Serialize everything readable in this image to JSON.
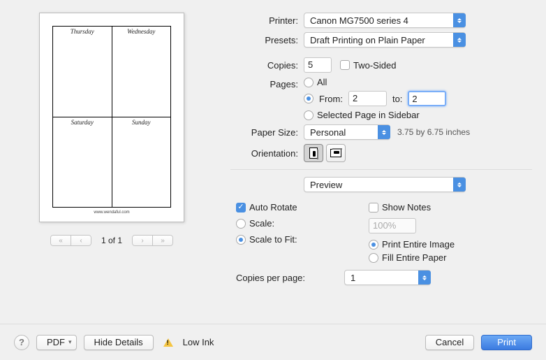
{
  "preview": {
    "cells": [
      "Thursday",
      "Wednesday",
      "Saturday",
      "Sunday"
    ],
    "watermark": "www.wendaful.com",
    "page_indicator": "1 of 1"
  },
  "labels": {
    "printer": "Printer:",
    "presets": "Presets:",
    "copies": "Copies:",
    "two_sided": "Two-Sided",
    "pages": "Pages:",
    "all": "All",
    "from": "From:",
    "to": "to:",
    "selected": "Selected Page in Sidebar",
    "paper_size": "Paper Size:",
    "orientation": "Orientation:",
    "auto_rotate": "Auto Rotate",
    "show_notes": "Show Notes",
    "scale": "Scale:",
    "scale_fit": "Scale to Fit:",
    "print_entire": "Print Entire Image",
    "fill_entire": "Fill Entire Paper",
    "copies_per_page": "Copies per page:"
  },
  "values": {
    "printer": "Canon MG7500 series 4",
    "preset": "Draft Printing on Plain Paper",
    "copies": "5",
    "from": "2",
    "to": "2",
    "paper_size": "Personal",
    "paper_dims": "3.75 by 6.75 inches",
    "section_menu": "Preview",
    "scale_pct": "100%",
    "copies_per_page": "1"
  },
  "footer": {
    "pdf": "PDF",
    "hide_details": "Hide Details",
    "low_ink": "Low Ink",
    "cancel": "Cancel",
    "print": "Print",
    "help": "?"
  }
}
